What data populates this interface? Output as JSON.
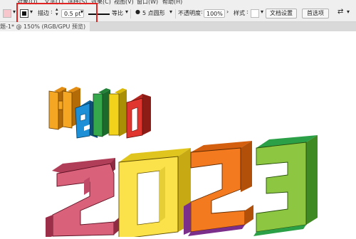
{
  "menu": {
    "items": [
      "对象(O)",
      "文字(T)",
      "选择(S)",
      "效果(C)",
      "视图(V)",
      "窗口(W)",
      "帮助(H)"
    ]
  },
  "control_bar": {
    "stroke_label": "描边",
    "stroke_value": "0.5 pt",
    "profile_label": "等比",
    "brush_value": "5 点圆形",
    "opacity_label": "不透明度",
    "opacity_value": "100%",
    "style_label": "样式",
    "doc_setup_button": "文档设置",
    "preferences_button": "首选项"
  },
  "tab": {
    "title": "题-1* @ 150% (RGB/GPU 预览)"
  },
  "artwork": {
    "line1": "Hello",
    "line2": "2023",
    "colors": {
      "H": "#f5a623",
      "e": "#1c8fd6",
      "l1": "#35a84b",
      "l2": "#f2d21b",
      "o": "#e0362f",
      "d2a": "#d9617a",
      "d0": "#fbe24a",
      "d2b": "#f47a1f",
      "d3": "#8dc640"
    }
  }
}
